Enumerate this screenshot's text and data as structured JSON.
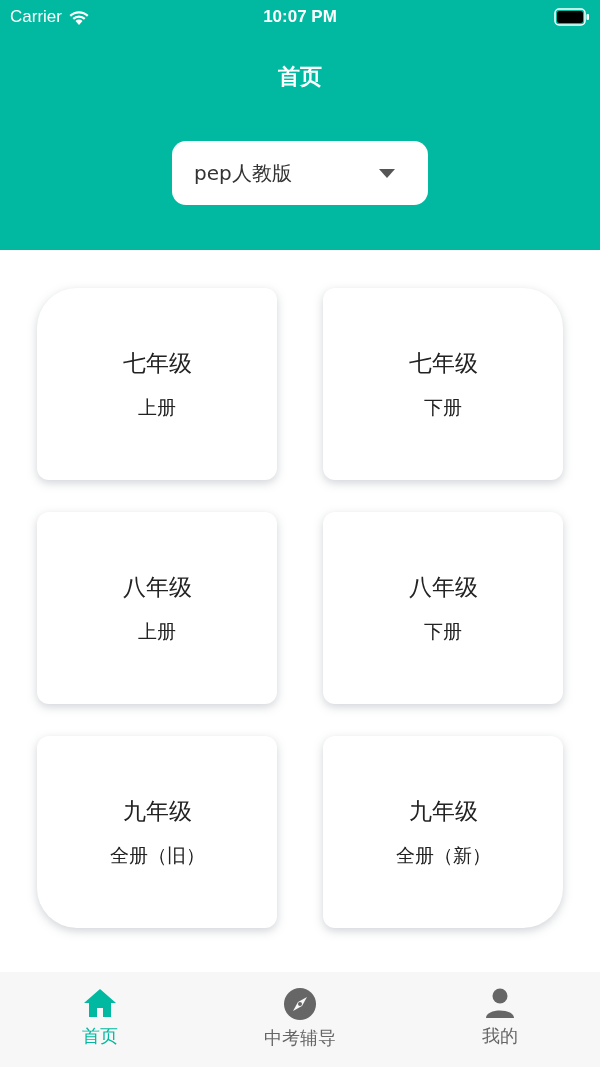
{
  "status_bar": {
    "carrier": "Carrier",
    "time": "10:07 PM"
  },
  "header": {
    "title": "首页"
  },
  "edition_select": {
    "value": "pep人教版"
  },
  "books": [
    {
      "grade": "七年级",
      "volume": "上册"
    },
    {
      "grade": "七年级",
      "volume": "下册"
    },
    {
      "grade": "八年级",
      "volume": "上册"
    },
    {
      "grade": "八年级",
      "volume": "下册"
    },
    {
      "grade": "九年级",
      "volume": "全册（旧）"
    },
    {
      "grade": "九年级",
      "volume": "全册（新）"
    }
  ],
  "tab_bar": [
    {
      "kind": "home",
      "label": "首页",
      "selected": true
    },
    {
      "kind": "compass",
      "label": "中考辅导",
      "selected": false
    },
    {
      "kind": "person",
      "label": "我的",
      "selected": false
    }
  ]
}
